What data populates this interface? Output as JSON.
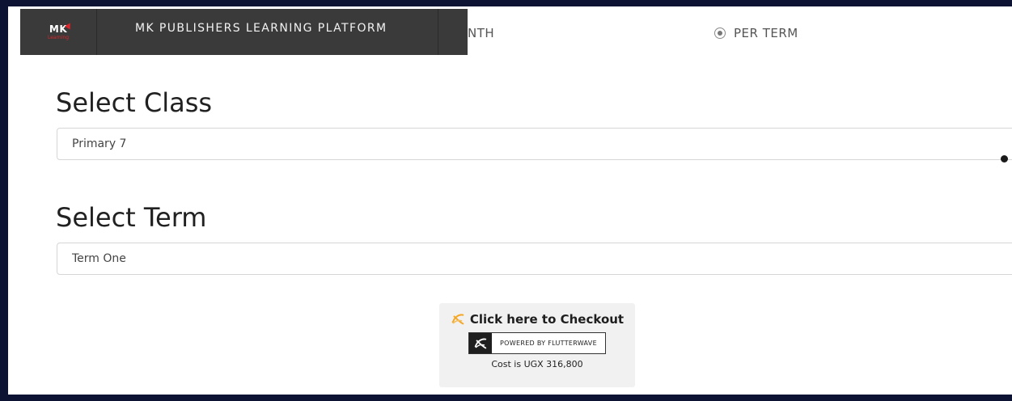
{
  "navbar": {
    "logo_text": "MK",
    "logo_subtext": "Learning",
    "brand_title": "MK PUBLISHERS LEARNING PLATFORM"
  },
  "plan_options": {
    "month_label_partial": "NTH",
    "term_label": "PER TERM",
    "selected": "PER TERM"
  },
  "class_section": {
    "heading": "Select Class",
    "selected_value": "Primary 7"
  },
  "term_section": {
    "heading": "Select Term",
    "selected_value": "Term One"
  },
  "checkout": {
    "button_label": "Click here to Checkout",
    "powered_by": "POWERED BY FLUTTERWAVE",
    "cost_text": "Cost is UGX 316,800"
  },
  "colors": {
    "outer_background": "#0d1433",
    "navbar": "#3a3a3a",
    "flutterwave_orange": "#f5a623"
  }
}
